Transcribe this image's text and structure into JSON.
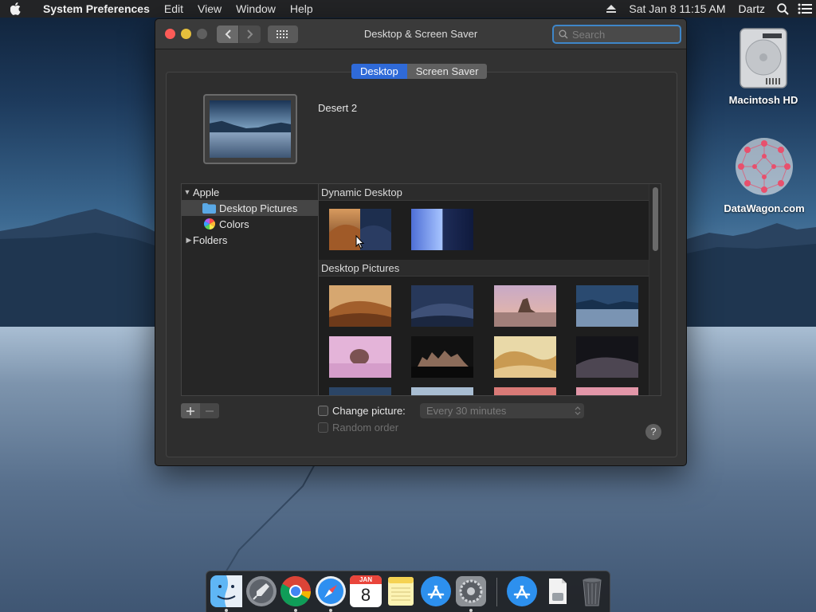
{
  "menubar": {
    "app_name": "System Preferences",
    "menus": [
      "Edit",
      "View",
      "Window",
      "Help"
    ],
    "datetime": "Sat Jan 8  11:15 AM",
    "user": "Dartz",
    "icons": [
      "apple-icon",
      "eject-icon",
      "spotlight-search-icon",
      "notification-center-icon"
    ]
  },
  "desktop": {
    "icons": [
      {
        "label": "Macintosh HD",
        "icon": "hard-drive-icon"
      },
      {
        "label": "DataWagon.com",
        "icon": "molecule-logo-icon"
      }
    ]
  },
  "window": {
    "title": "Desktop & Screen Saver",
    "search_placeholder": "Search",
    "tabs": [
      {
        "label": "Desktop",
        "active": true
      },
      {
        "label": "Screen Saver",
        "active": false
      }
    ],
    "current_picture": "Desert 2",
    "sidebar": {
      "apple_group": "Apple",
      "items": [
        {
          "label": "Desktop Pictures",
          "icon": "folder-icon",
          "selected": true
        },
        {
          "label": "Colors",
          "icon": "color-wheel-icon",
          "selected": false
        }
      ],
      "folders_group": "Folders"
    },
    "gallery": {
      "sections": [
        "Dynamic Desktop",
        "Desktop Pictures"
      ]
    },
    "change_picture_label": "Change picture:",
    "interval_value": "Every 30 minutes",
    "random_order_label": "Random order",
    "help_label": "?"
  },
  "dock": {
    "apps": [
      "Finder",
      "Launchpad",
      "Google Chrome",
      "Safari",
      "Calendar",
      "Notes",
      "App Store",
      "System Preferences",
      "App Store Download",
      "Documents",
      "Trash"
    ],
    "calendar_month": "JAN",
    "calendar_day": "8"
  },
  "colors": {
    "accent": "#2f6ad8",
    "window_bg": "#323232",
    "close": "#fc5b57",
    "minimize": "#e5bf3c"
  }
}
